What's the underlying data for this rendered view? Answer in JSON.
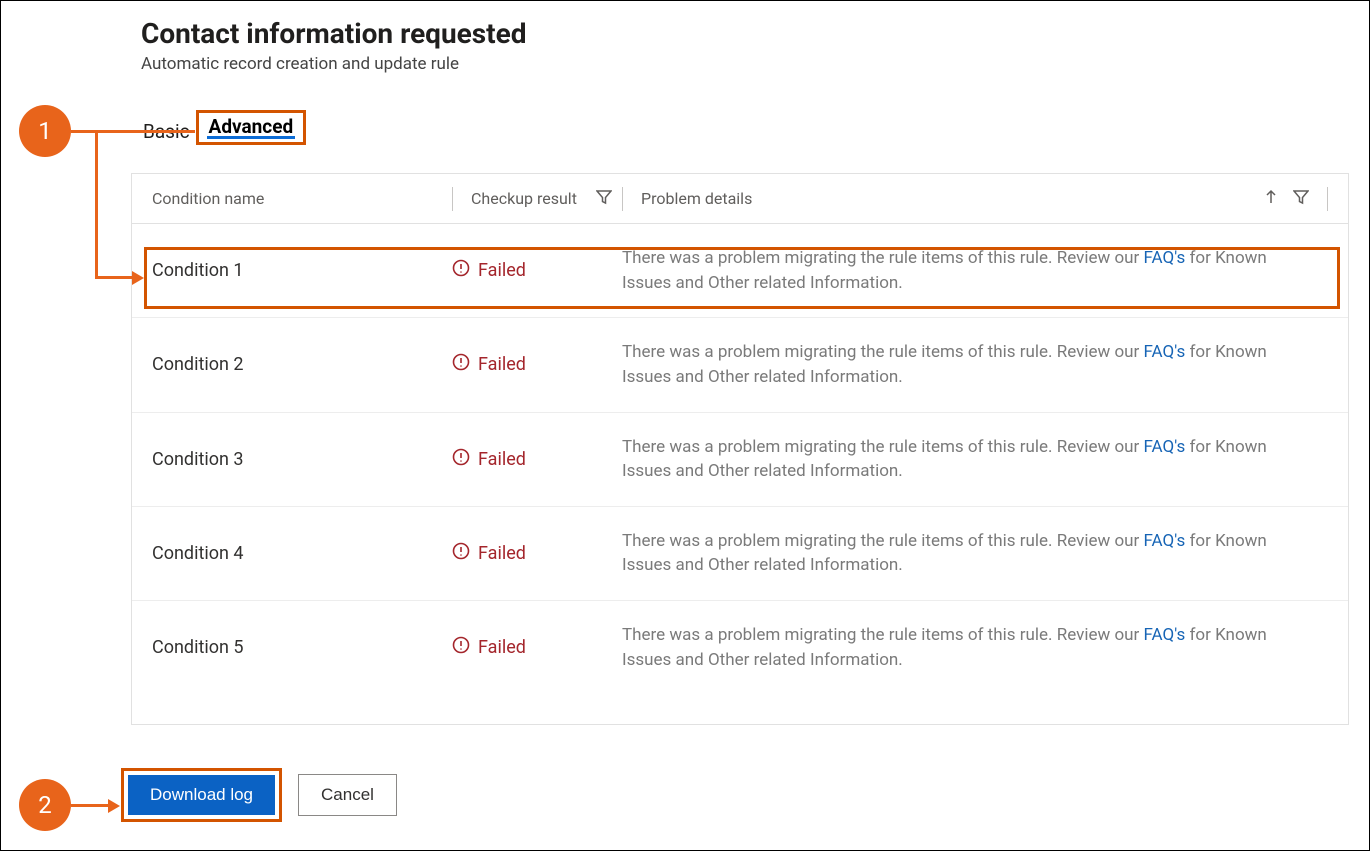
{
  "header": {
    "title": "Contact information requested",
    "subtitle": "Automatic record creation and update rule"
  },
  "tabs": {
    "basic": "Basic",
    "advanced": "Advanced"
  },
  "grid": {
    "headers": {
      "condition": "Condition name",
      "result": "Checkup result",
      "details": "Problem details"
    },
    "failed_label": "Failed",
    "details_prefix": "There was a problem migrating the rule items of this rule. Review our ",
    "faq_text": "FAQ's",
    "details_suffix": " for Known Issues and Other related Information.",
    "rows": [
      {
        "name": "Condition 1"
      },
      {
        "name": "Condition 2"
      },
      {
        "name": "Condition 3"
      },
      {
        "name": "Condition 4"
      },
      {
        "name": "Condition 5"
      }
    ]
  },
  "buttons": {
    "download": "Download log",
    "cancel": "Cancel"
  },
  "callouts": {
    "one": "1",
    "two": "2"
  }
}
